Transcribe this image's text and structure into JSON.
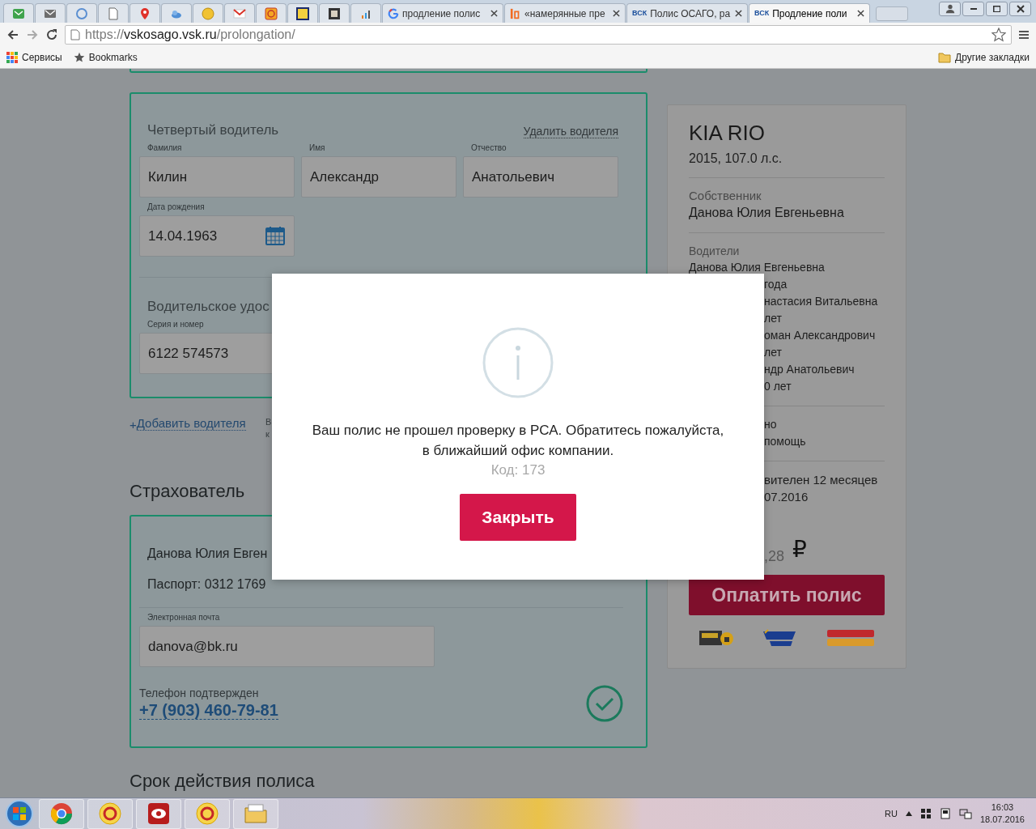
{
  "browser": {
    "tabs": [
      {
        "kind": "google",
        "title": "продление полис",
        "selected": false
      },
      {
        "kind": "orange",
        "title": "«намерянные пре",
        "selected": false
      },
      {
        "kind": "vsk",
        "badge": "ВСК",
        "title": "Полис ОСАГО, ра",
        "selected": false
      },
      {
        "kind": "vsk",
        "badge": "ВСК",
        "title": "Продление поли",
        "selected": true
      }
    ],
    "address": {
      "scheme": "https://",
      "host": "vskosago.vsk.ru",
      "path": "/prolongation/"
    },
    "bookmarks": [
      {
        "kind": "apps",
        "label": "Сервисы"
      },
      {
        "kind": "star",
        "label": "Bookmarks"
      }
    ],
    "other_bookmarks": "Другие закладки"
  },
  "form": {
    "driver": {
      "title": "Четвертый водитель",
      "remove": "Удалить водителя",
      "fields": [
        {
          "kind": "text",
          "label": "Фамилия",
          "value": "Килин"
        },
        {
          "kind": "text",
          "label": "Имя",
          "value": "Александр"
        },
        {
          "kind": "text",
          "label": "Отчество",
          "value": "Анатольевич"
        },
        {
          "kind": "date",
          "label": "Дата рождения",
          "value": "14.04.1963"
        }
      ],
      "license_title": "Водительское удос",
      "license_field": {
        "label": "Серия и номер",
        "value": "6122 574573"
      }
    },
    "add_driver": {
      "icon": "+",
      "label": "Добавить водителя"
    },
    "side_note": [
      "В",
      "к"
    ],
    "insurer_title": "Страхователь",
    "insurer": {
      "name": "Данова Юлия Евген",
      "passport": "Паспорт: 0312 1769",
      "email": {
        "label": "Электронная почта",
        "value": "danova@bk.ru"
      },
      "phone_label": "Телефон подтвержден",
      "phone": "+7 (903) 460-79-81",
      "phone_confirmed": true
    },
    "next_title": "Срок действия полиса"
  },
  "summary": {
    "car": "KIA RIO",
    "specs": "2015, 107.0 л.с.",
    "owner_label": "Собственник",
    "owner": "Данова Юлия Евгеньевна",
    "drivers_label": "Водители",
    "drivers": [
      {
        "text": "Данова Юлия Евгеньевна",
        "covered": false
      },
      {
        "text": "года",
        "covered": true
      },
      {
        "text": "настасия Витальевна",
        "covered": true
      },
      {
        "text": "лет",
        "covered": true
      },
      {
        "text": "оман Александрович",
        "covered": true
      },
      {
        "text": "лет",
        "covered": true
      },
      {
        "text": "ндр Анатольевич",
        "covered": true
      },
      {
        "text": "0 лет",
        "covered": true
      }
    ],
    "extras": [
      {
        "text": "но",
        "covered": true
      },
      {
        "text": "помощь",
        "covered": true
      }
    ],
    "term": [
      {
        "text": "вителен 12 месяцев",
        "covered": true
      },
      {
        "text": "07.2016",
        "covered": true
      }
    ],
    "price": ",28",
    "currency": "₽",
    "pay_button": "Оплатить полис"
  },
  "modal": {
    "message": "Ваш полис не прошел проверку в РСА. Обратитесь пожалуйста,\nв ближайший офис компании.",
    "code": "Код: 173",
    "button": "Закрыть"
  },
  "taskbar": {
    "language": "RU",
    "time": "16:03",
    "date": "18.07.2016"
  }
}
